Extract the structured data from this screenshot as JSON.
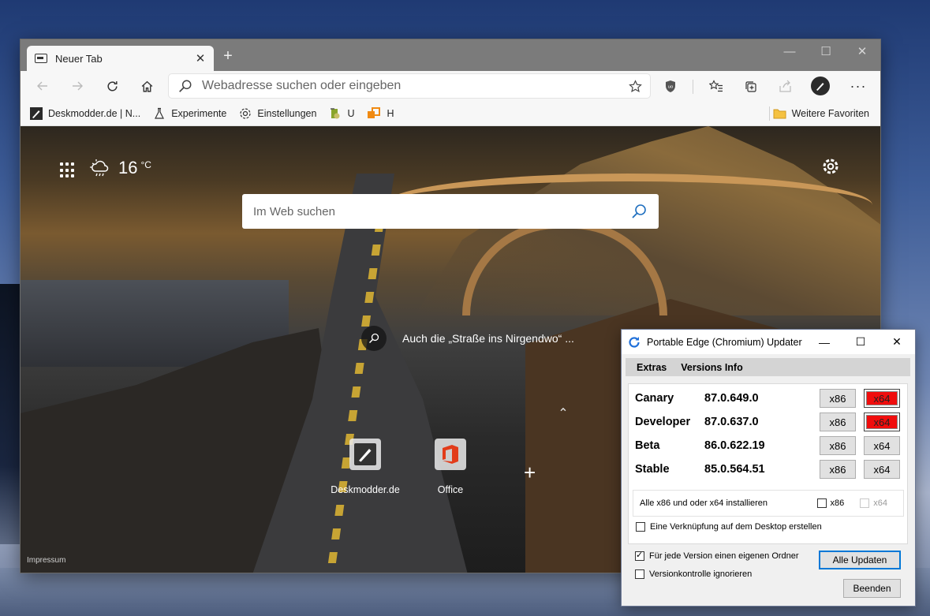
{
  "browser": {
    "tab": {
      "title": "Neuer Tab",
      "close": "✕"
    },
    "new_tab": "+",
    "window_controls": {
      "minimize": "—",
      "maximize": "☐",
      "close": "✕"
    },
    "address": {
      "placeholder": "Webadresse suchen oder eingeben"
    },
    "favorites": [
      {
        "label": "Deskmodder.de | N...",
        "icon": "brush-icon"
      },
      {
        "label": "Experimente",
        "icon": "flask-icon"
      },
      {
        "label": "Einstellungen",
        "icon": "gear-icon"
      },
      {
        "label": "U",
        "icon": "extension-icon"
      },
      {
        "label": "H",
        "icon": "extension-icon"
      }
    ],
    "more_favorites": "Weitere Favoriten"
  },
  "newtab": {
    "temperature": "16",
    "unit": "°C",
    "search_placeholder": "Im Web suchen",
    "image_caption": "Auch die „Straße ins Nirgendwo“ ...",
    "tiles": [
      {
        "label": "Deskmodder.de",
        "icon": "brush-icon"
      },
      {
        "label": "Office",
        "icon": "office-icon"
      }
    ],
    "add_tile": "+",
    "chevron": "⌃",
    "impressum": "Impressum"
  },
  "updater": {
    "title": "Portable Edge (Chromium) Updater",
    "controls": {
      "minimize": "—",
      "maximize": "☐",
      "close": "✕"
    },
    "menu": [
      "Extras",
      "Versions Info"
    ],
    "versions": [
      {
        "channel": "Canary",
        "version": "87.0.649.0",
        "x86": "x86",
        "x64": "x64",
        "x64_highlight": true
      },
      {
        "channel": "Developer",
        "version": "87.0.637.0",
        "x86": "x86",
        "x64": "x64",
        "x64_highlight": true
      },
      {
        "channel": "Beta",
        "version": "86.0.622.19",
        "x86": "x86",
        "x64": "x64",
        "x64_highlight": false
      },
      {
        "channel": "Stable",
        "version": "85.0.564.51",
        "x86": "x86",
        "x64": "x64",
        "x64_highlight": false
      }
    ],
    "install_all_label": "Alle x86 und oder x64 installieren",
    "install_x86": {
      "label": "x86",
      "checked": false
    },
    "install_x64": {
      "label": "x64",
      "checked": false,
      "disabled": true
    },
    "desktop_shortcut": {
      "label": "Eine Verknüpfung auf dem Desktop erstellen",
      "checked": false
    },
    "own_folder": {
      "label": "Für jede Version einen eigenen Ordner",
      "checked": true
    },
    "ignore_version_control": {
      "label": "Versionkontrolle ignorieren",
      "checked": false
    },
    "update_all": "Alle Updaten",
    "quit": "Beenden",
    "highlight_color": "#f00d0d"
  }
}
